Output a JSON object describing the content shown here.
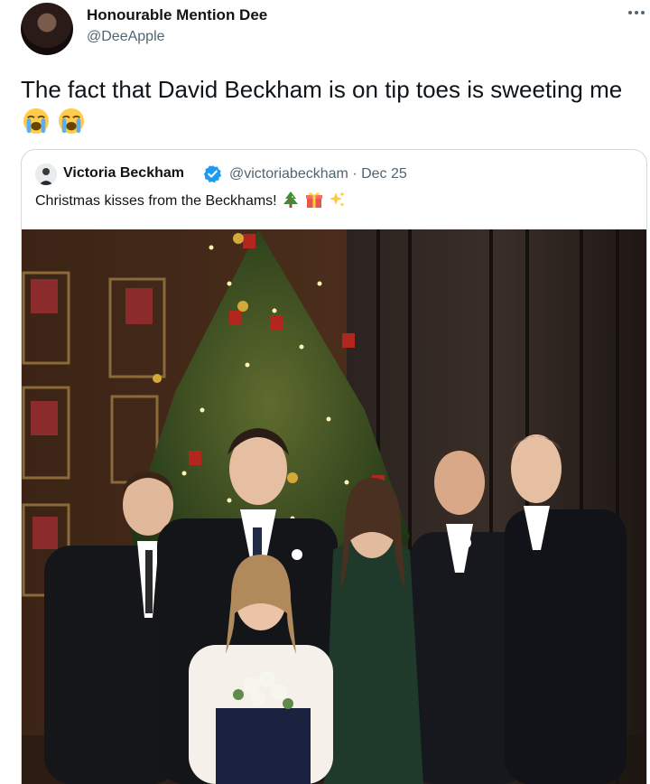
{
  "tweet": {
    "author": {
      "name": "Honourable Mention Dee",
      "handle": "@DeeApple"
    },
    "text": "The fact that David Beckham is on tip toes is sweeting me",
    "emojis": [
      "loudly-crying-face",
      "loudly-crying-face"
    ]
  },
  "quoted_tweet": {
    "author": {
      "name": "Victoria Beckham",
      "handle": "@victoriabeckham",
      "verified": true
    },
    "meta": "@victoriabeckham · Dec 25",
    "text": "Christmas kisses from the Beckhams!",
    "emojis": [
      "christmas-tree",
      "wrapped-gift",
      "sparkles"
    ],
    "media": {
      "type": "photo"
    }
  },
  "colors": {
    "text": "#0f1419",
    "secondary": "#536471",
    "border": "#cfd9de",
    "verified": "#1d9bf0"
  }
}
